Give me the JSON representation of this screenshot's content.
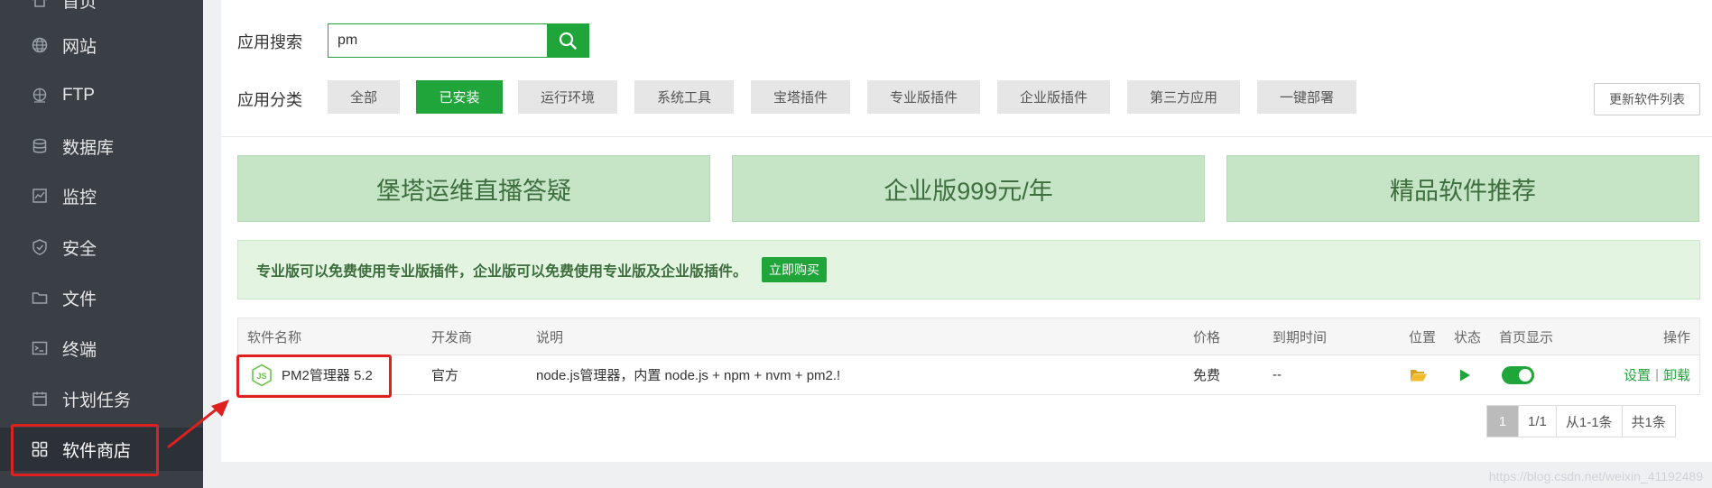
{
  "sidebar": {
    "items": [
      {
        "label": "首页",
        "icon": "home-icon"
      },
      {
        "label": "网站",
        "icon": "globe-icon"
      },
      {
        "label": "FTP",
        "icon": "ftp-icon"
      },
      {
        "label": "数据库",
        "icon": "database-icon"
      },
      {
        "label": "监控",
        "icon": "monitor-icon"
      },
      {
        "label": "安全",
        "icon": "shield-icon"
      },
      {
        "label": "文件",
        "icon": "folder-icon"
      },
      {
        "label": "终端",
        "icon": "terminal-icon"
      },
      {
        "label": "计划任务",
        "icon": "calendar-icon"
      },
      {
        "label": "软件商店",
        "icon": "grid-icon",
        "active": true
      }
    ]
  },
  "search": {
    "label": "应用搜索",
    "value": "pm"
  },
  "categories": {
    "label": "应用分类",
    "items": [
      "全部",
      "已安装",
      "运行环境",
      "系统工具",
      "宝塔插件",
      "专业版插件",
      "企业版插件",
      "第三方应用",
      "一键部署"
    ],
    "active_index": 1
  },
  "update_button": "更新软件列表",
  "banners": [
    "堡塔运维直播答疑",
    "企业版999元/年",
    "精品软件推荐"
  ],
  "notice": {
    "text": "专业版可以免费使用专业版插件，企业版可以免费使用专业版及企业版插件。",
    "buy_label": "立即购买"
  },
  "table": {
    "headers": {
      "name": "软件名称",
      "developer": "开发商",
      "description": "说明",
      "price": "价格",
      "expiry": "到期时间",
      "location": "位置",
      "status": "状态",
      "homepage": "首页显示",
      "actions": "操作"
    },
    "rows": [
      {
        "name": "PM2管理器 5.2",
        "developer": "官方",
        "description": "node.js管理器，内置 node.js + npm + nvm + pm2.!",
        "price": "免费",
        "expiry": "--",
        "homepage_on": true,
        "action_settings": "设置",
        "action_separator": "|",
        "action_uninstall": "卸载"
      }
    ]
  },
  "pager": {
    "current": "1",
    "pages": "1/1",
    "range": "从1-1条",
    "total": "共1条"
  },
  "watermark": "https://blog.csdn.net/weixin_41192489",
  "colors": {
    "accent": "#20a53a",
    "sidebar_bg": "#3a3f46",
    "highlight": "#e0201e"
  }
}
